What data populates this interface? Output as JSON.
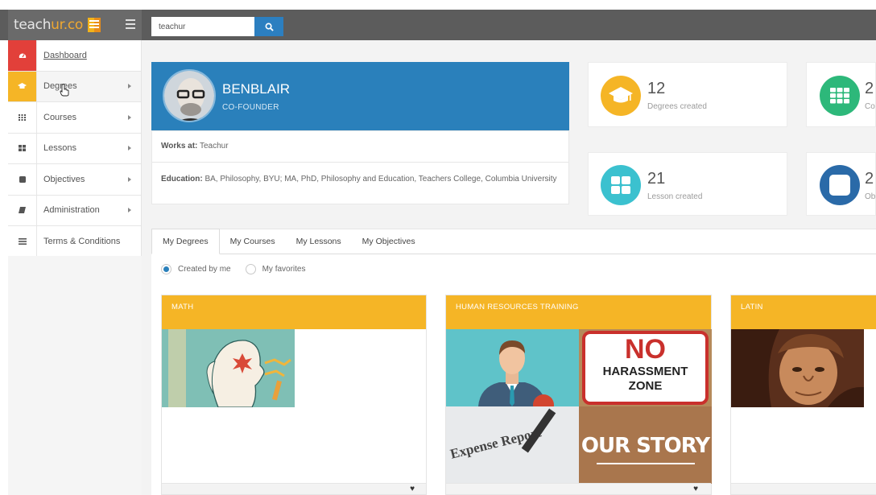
{
  "header": {
    "brand_main": "teach",
    "brand_accent": "ur.co",
    "search_value": "teachur"
  },
  "sidebar": {
    "items": [
      {
        "label": "Dashboard",
        "icon": "dashboard-icon",
        "color": "#e2403a"
      },
      {
        "label": "Degrees",
        "icon": "graduation-cap-icon",
        "color": "#f5b526"
      },
      {
        "label": "Courses",
        "icon": "grid-icon"
      },
      {
        "label": "Lessons",
        "icon": "blocks-icon"
      },
      {
        "label": "Objectives",
        "icon": "square-icon"
      },
      {
        "label": "Administration",
        "icon": "book-icon"
      },
      {
        "label": "Terms & Conditions",
        "icon": "list-icon"
      }
    ]
  },
  "profile": {
    "name": "BENBLAIR",
    "role": "CO-FOUNDER",
    "works_label": "Works at:",
    "works_value": "Teachur",
    "education_label": "Education:",
    "education_value": "BA, Philosophy, BYU; MA, PhD, Philosophy and Education, Teachers College, Columbia University"
  },
  "stats": [
    {
      "number": "12",
      "label": "Degrees created",
      "color": "#f5b526",
      "icon": "graduation-cap-icon"
    },
    {
      "number": "2",
      "label": "Co",
      "color": "#2db87a",
      "icon": "grid-icon"
    },
    {
      "number": "21",
      "label": "Lesson created",
      "color": "#3bc1cf",
      "icon": "blocks-icon"
    },
    {
      "number": "2",
      "label": "Ob",
      "color": "#2a6aa8",
      "icon": "square-icon"
    }
  ],
  "tabs": [
    "My Degrees",
    "My Courses",
    "My Lessons",
    "My Objectives"
  ],
  "filters": {
    "created_by_me": "Created by me",
    "my_favorites": "My favorites"
  },
  "degree_cards": [
    {
      "title": "MATH"
    },
    {
      "title": "HUMAN RESOURCES TRAINING",
      "tiles": [
        "NO",
        "HARASSMENT",
        "ZONE",
        "Expense Report",
        "OUR STORY"
      ]
    },
    {
      "title": "LATIN"
    }
  ],
  "colors": {
    "brand_blue": "#2a80bb",
    "card_yellow": "#f5b526"
  }
}
